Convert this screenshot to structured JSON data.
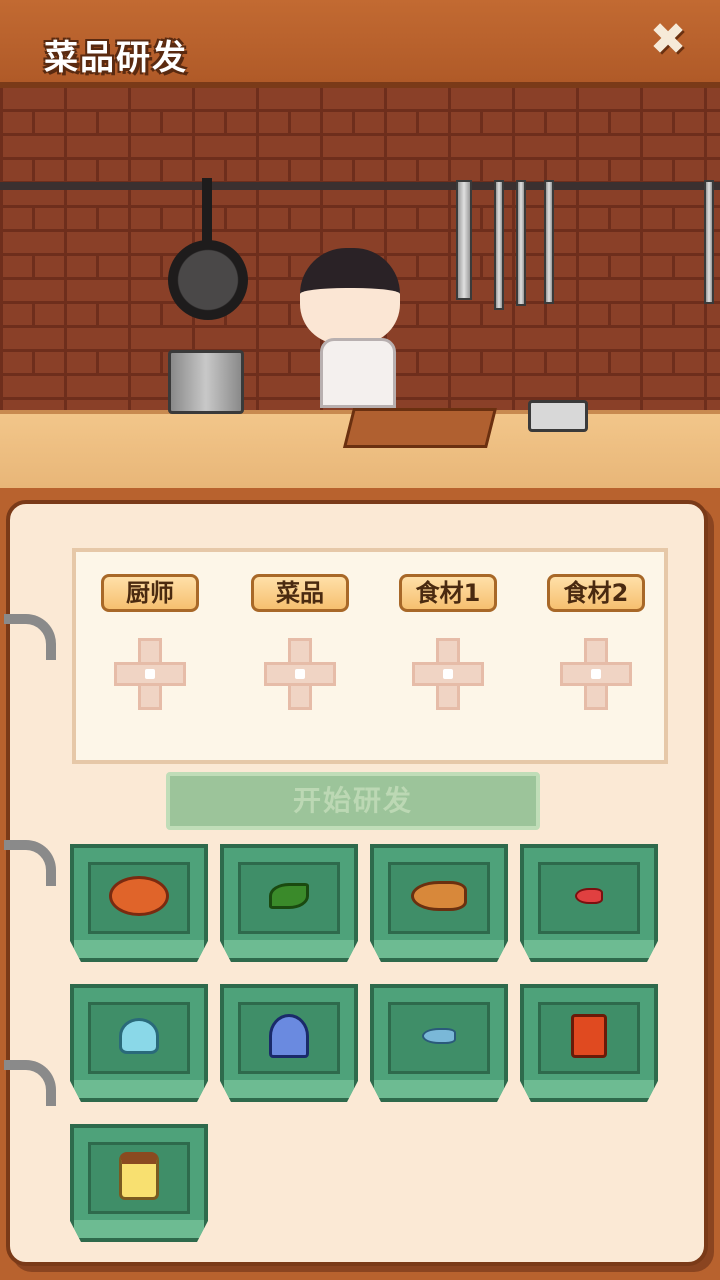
{
  "header": {
    "title": "菜品研发",
    "close_icon": "close-icon"
  },
  "scene": {
    "description_icons": [
      "frying-pan-icon",
      "pot-icon",
      "knife-icon",
      "chef-character",
      "cutting-board-icon",
      "toaster-icon"
    ]
  },
  "slots": [
    {
      "label": "厨师"
    },
    {
      "label": "菜品"
    },
    {
      "label": "食材1"
    },
    {
      "label": "食材2"
    }
  ],
  "start_button": {
    "label": "开始研发",
    "enabled": false
  },
  "ingredients": [
    {
      "icon": "pumpkin-icon"
    },
    {
      "icon": "leaf-icon"
    },
    {
      "icon": "fish-icon"
    },
    {
      "icon": "small-red-fish-icon"
    },
    {
      "icon": "shell-icon"
    },
    {
      "icon": "squid-icon"
    },
    {
      "icon": "blue-fish-icon"
    },
    {
      "icon": "chili-pack-icon"
    },
    {
      "icon": "honey-jar-icon"
    }
  ],
  "colors": {
    "header": "#b8622e",
    "notebook": "#fbe9d5",
    "tray": "#4ea27a",
    "slot_label": "#f6c070",
    "start_button_disabled": "#9cc49a"
  }
}
